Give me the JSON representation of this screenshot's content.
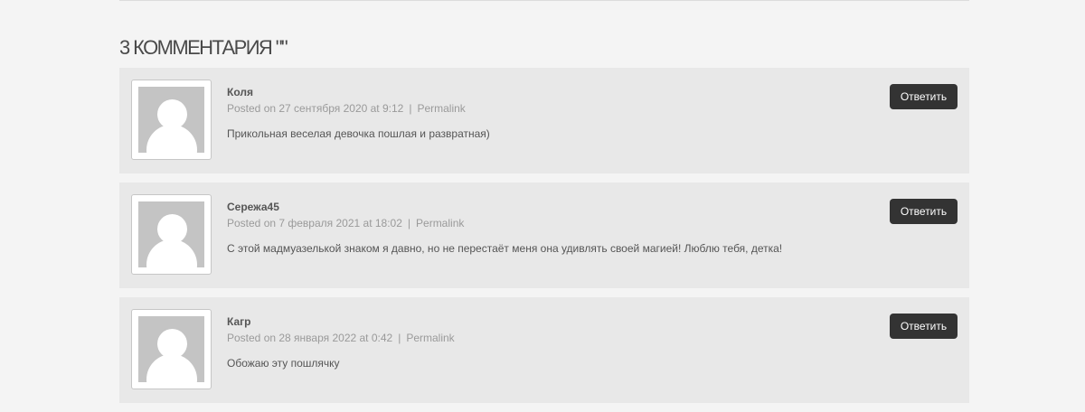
{
  "heading": "3 комментария \"\"",
  "reply_label": "Ответить",
  "comments": [
    {
      "author": "Коля",
      "posted": "Posted on 27 сентября 2020 at 9:12",
      "separator": "|",
      "permalink": "Permalink",
      "text": "Прикольная веселая девочка пошлая и развратная)"
    },
    {
      "author": "Сережа45",
      "posted": "Posted on 7 февраля 2021 at 18:02",
      "separator": "|",
      "permalink": "Permalink",
      "text": "С этой мадмуазелькой знаком я давно, но не перестаёт меня она удивлять своей магией! Люблю тебя, детка!"
    },
    {
      "author": "Кагр",
      "posted": "Posted on 28 января 2022 at 0:42",
      "separator": "|",
      "permalink": "Permalink",
      "text": "Обожаю эту пошлячку"
    }
  ],
  "colors": {
    "page_bg": "#f4f4f4",
    "card_bg": "#e8e8e8",
    "button_bg": "#333333",
    "button_text": "#ffffff",
    "meta_text": "#9a9a9a",
    "avatar_placeholder": "#c4c4c4"
  },
  "icons": {
    "avatar": "default-user-avatar-icon"
  }
}
